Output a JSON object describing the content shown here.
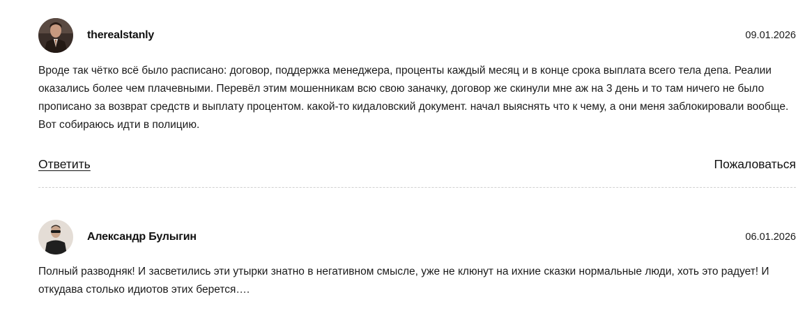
{
  "comments": [
    {
      "author": "therealstanly",
      "date": "09.01.2026",
      "avatar_icon": "user-photo-man-in-suit",
      "text": "Вроде так чётко всё было расписано: договор, поддержка менеджера, проценты каждый месяц и в конце срока выплата всего тела депа. Реалии оказались более чем плачевными. Перевёл этим мошенникам всю свою заначку, договор же скинули мне аж на 3 день и то там ничего не было прописано за возврат средств и выплату процентом. какой-то кидаловский документ. начал выяснять что к чему, а они меня заблокировали вообще. Вот собираюсь идти в полицию.",
      "reply_label": "Ответить",
      "report_label": "Пожаловаться"
    },
    {
      "author": "Александр Булыгин",
      "date": "06.01.2026",
      "avatar_icon": "user-photo-man-in-sunglasses",
      "text": "Полный разводняк! И засветились эти утырки знатно в негативном смысле, уже не клюнут на ихние сказки нормальные люди, хоть это радует! И откудава столько идиотов этих берется…."
    }
  ]
}
